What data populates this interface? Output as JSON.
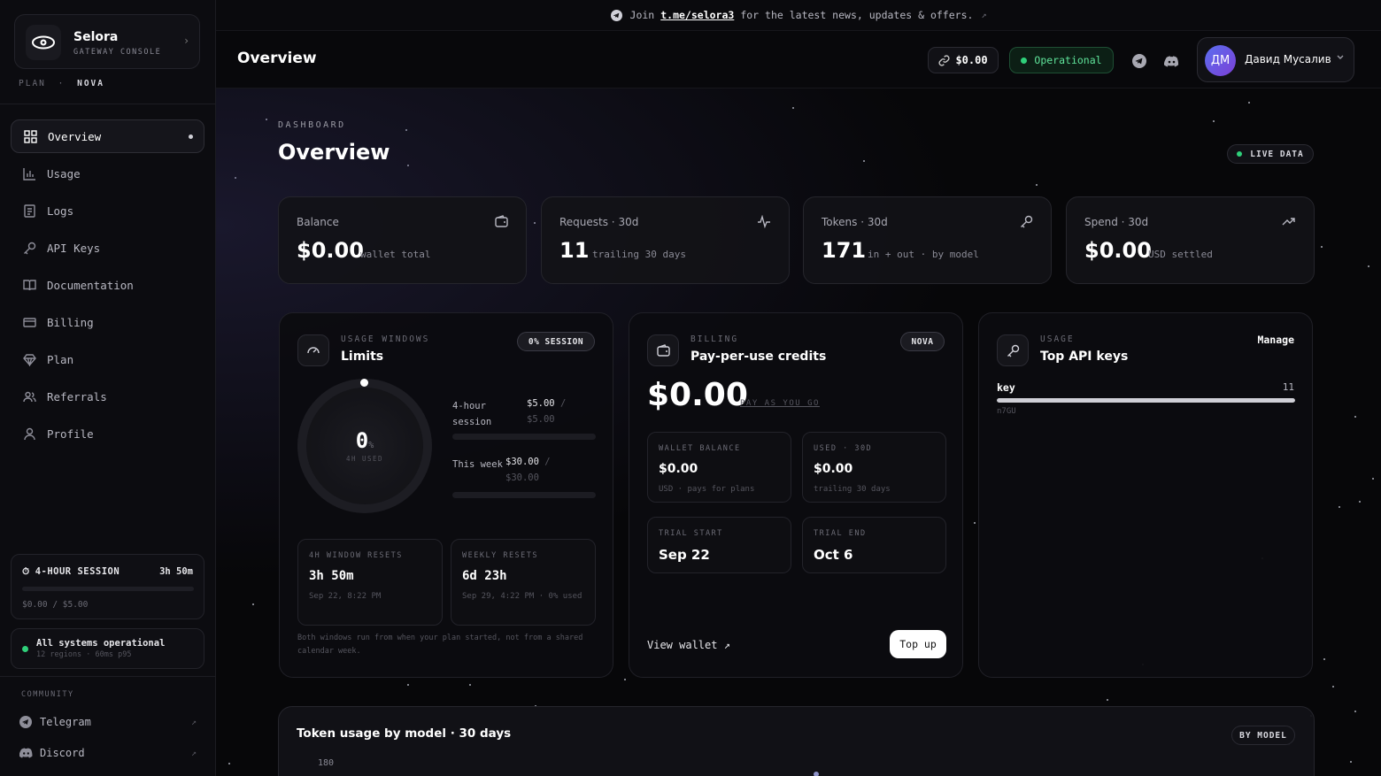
{
  "banner": {
    "prefix": "Join",
    "link": "t.me/selora3",
    "suffix": "for the latest news, updates & offers."
  },
  "brand": {
    "name": "Selora",
    "subtitle": "GATEWAY CONSOLE"
  },
  "plan": {
    "label": "PLAN",
    "sep": "·",
    "value": "NOVA"
  },
  "nav": {
    "items": [
      {
        "label": "Overview",
        "icon": "grid-icon",
        "active": true
      },
      {
        "label": "Usage",
        "icon": "bar-chart-icon"
      },
      {
        "label": "Logs",
        "icon": "log-icon"
      },
      {
        "label": "API Keys",
        "icon": "key-icon"
      },
      {
        "label": "Documentation",
        "icon": "book-icon"
      },
      {
        "label": "Billing",
        "icon": "card-icon"
      },
      {
        "label": "Plan",
        "icon": "diamond-icon"
      },
      {
        "label": "Referrals",
        "icon": "users-icon"
      },
      {
        "label": "Profile",
        "icon": "user-icon"
      }
    ]
  },
  "session": {
    "title": "4-HOUR SESSION",
    "time": "3h 50m",
    "amount": "$0.00 / $5.00",
    "progress": 0
  },
  "system": {
    "title": "All systems operational",
    "sub": "12 regions · 60ms p95",
    "color": "#2fd07a"
  },
  "community": {
    "label": "COMMUNITY",
    "links": [
      {
        "label": "Telegram",
        "icon": "telegram-icon"
      },
      {
        "label": "Discord",
        "icon": "discord-icon"
      }
    ]
  },
  "header": {
    "title": "Overview",
    "balance": "$0.00",
    "status": "Operational",
    "user": {
      "initials": "ДМ",
      "name": "Давид Мусалив"
    }
  },
  "page": {
    "crumb": "DASHBOARD",
    "title": "Overview",
    "live": "LIVE DATA"
  },
  "stats": [
    {
      "label": "Balance",
      "value": "$0.00",
      "sub": "wallet total",
      "icon": "wallet-icon"
    },
    {
      "label": "Requests · 30d",
      "value": "11",
      "sub": "trailing 30 days",
      "icon": "pulse-icon"
    },
    {
      "label": "Tokens · 30d",
      "value": "171",
      "sub": "in + out · by model",
      "icon": "key-icon"
    },
    {
      "label": "Spend · 30d",
      "value": "$0.00",
      "sub": "USD settled",
      "icon": "trend-up-icon"
    }
  ],
  "limits": {
    "kicker": "USAGE WINDOWS",
    "title": "Limits",
    "badge": "0% SESSION",
    "gauge": {
      "value": "0",
      "unit": "%",
      "caption": "4H USED"
    },
    "rows": [
      {
        "name": "4-hour session",
        "used": "$5.00",
        "sep": "/",
        "limit": "$5.00",
        "progress": 0
      },
      {
        "name": "This week",
        "used": "$30.00",
        "sep": "/",
        "limit": "$30.00",
        "progress": 0
      }
    ],
    "resets": [
      {
        "label": "4H WINDOW RESETS",
        "value": "3h 50m",
        "sub": "Sep 22, 8:22 PM"
      },
      {
        "label": "WEEKLY RESETS",
        "value": "6d 23h",
        "sub": "Sep 29, 4:22 PM · 0% used"
      }
    ],
    "note": "Both windows run from when your plan started, not from a shared calendar week."
  },
  "billing": {
    "kicker": "BILLING",
    "title": "Pay-per-use credits",
    "badge": "NOVA",
    "amount": "$0.00",
    "tag": "PAY AS YOU GO",
    "cards": [
      {
        "label": "WALLET BALANCE",
        "value": "$0.00",
        "sub": "USD · pays for plans"
      },
      {
        "label": "USED · 30D",
        "value": "$0.00",
        "sub": "trailing 30 days"
      },
      {
        "label": "TRIAL START",
        "value": "Sep 22"
      },
      {
        "label": "TRIAL END",
        "value": "Oct 6"
      }
    ],
    "view_wallet": "View wallet ↗",
    "top_up": "Top up"
  },
  "keys": {
    "kicker": "USAGE",
    "title": "Top API keys",
    "manage": "Manage",
    "items": [
      {
        "name": "key",
        "count": "11",
        "id": "n7GU",
        "share": 1.0
      }
    ]
  },
  "chart": {
    "title": "Token usage by model · 30 days",
    "badge": "BY MODEL",
    "ytick": "180"
  },
  "colors": {
    "accent": "#2fd07a",
    "background": "#070709"
  }
}
